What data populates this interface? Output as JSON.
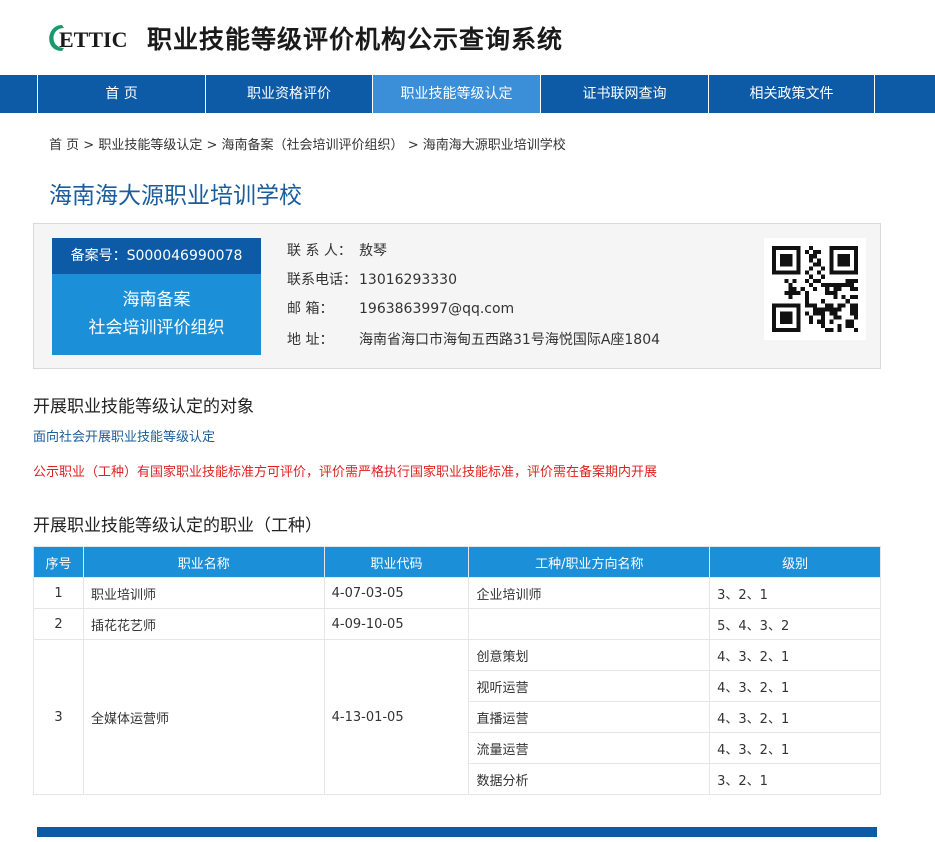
{
  "header": {
    "logo_text": "ETTIC",
    "site_title": "职业技能等级评价机构公示查询系统"
  },
  "nav": [
    {
      "label": "首    页",
      "active": false
    },
    {
      "label": "职业资格评价",
      "active": false
    },
    {
      "label": "职业技能等级认定",
      "active": true
    },
    {
      "label": "证书联网查询",
      "active": false
    },
    {
      "label": "相关政策文件",
      "active": false
    }
  ],
  "breadcrumb": {
    "home": "首 页",
    "level1": "职业技能等级认定",
    "level2": "海南备案（社会培训评价组织）",
    "level3": "海南海大源职业培训学校",
    "separator": ">"
  },
  "org": {
    "name": "海南海大源职业培训学校",
    "record_label": "备案号：",
    "record_no": "S000046990078",
    "type_line1": "海南备案",
    "type_line2": "社会培训评价组织",
    "contacts": [
      {
        "label": "联 系 人：",
        "value": "敖琴"
      },
      {
        "label": "联系电话：",
        "value": "13016293330"
      },
      {
        "label": "邮      箱：",
        "value": "1963863997@qq.com"
      },
      {
        "label": "地      址：",
        "value": "海南省海口市海甸五西路31号海悦国际A座1804"
      }
    ],
    "qr_icon": "qr-code-icon"
  },
  "section1": {
    "title": "开展职业技能等级认定的对象",
    "target": "面向社会开展职业技能等级认定",
    "notice": "公示职业（工种）有国家职业技能标准方可评价，评价需严格执行国家职业技能标准，评价需在备案期内开展"
  },
  "section2": {
    "title": "开展职业技能等级认定的职业（工种）",
    "columns": [
      "序号",
      "职业名称",
      "职业代码",
      "工种/职业方向名称",
      "级别"
    ],
    "rows": [
      {
        "no": "1",
        "name": "职业培训师",
        "code": "4-07-03-05",
        "subs": [
          {
            "sub": "企业培训师",
            "level": "3、2、1"
          }
        ]
      },
      {
        "no": "2",
        "name": "插花花艺师",
        "code": "4-09-10-05",
        "subs": [
          {
            "sub": "",
            "level": "5、4、3、2"
          }
        ]
      },
      {
        "no": "3",
        "name": "全媒体运营师",
        "code": "4-13-01-05",
        "subs": [
          {
            "sub": "创意策划",
            "level": "4、3、2、1"
          },
          {
            "sub": "视听运营",
            "level": "4、3、2、1"
          },
          {
            "sub": "直播运营",
            "level": "4、3、2、1"
          },
          {
            "sub": "流量运营",
            "level": "4、3、2、1"
          },
          {
            "sub": "数据分析",
            "level": "3、2、1"
          }
        ]
      }
    ]
  },
  "colors": {
    "nav_bg": "#0d5aa7",
    "nav_active": "#3b8fd9",
    "accent_blue": "#1b8fd7",
    "title_blue": "#1b5d9c",
    "notice_red": "#e02020",
    "logo_green": "#1a9a6c"
  }
}
